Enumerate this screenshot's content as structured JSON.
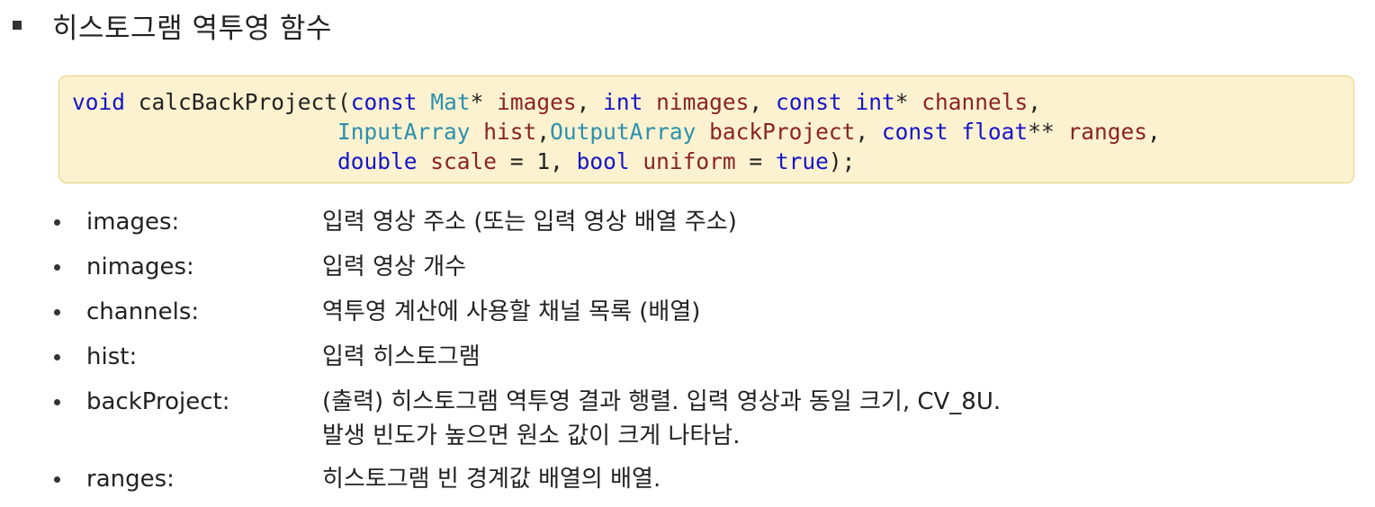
{
  "title": "히스토그램 역투영 함수",
  "code": {
    "line1": {
      "kw_void": "void",
      "fn": " calcBackProject(",
      "kw_const1": "const",
      "sp1": " ",
      "ty_mat": "Mat",
      "p1": "* ",
      "v_images": "images",
      "p2": ", ",
      "kw_int1": "int",
      "sp2": " ",
      "v_nimages": "nimages",
      "p3": ", ",
      "kw_const2": "const",
      "sp3": " ",
      "kw_int2": "int",
      "p4": "* ",
      "v_channels": "channels",
      "p5": ","
    },
    "line2": {
      "indent": "                    ",
      "ty_input": "InputArray",
      "sp1": " ",
      "v_hist": "hist",
      "p1": ",",
      "ty_output": "OutputArray",
      "sp2": " ",
      "v_backproject": "backProject",
      "p2": ", ",
      "kw_const": "const",
      "sp3": " ",
      "kw_float": "float",
      "p3": "** ",
      "v_ranges": "ranges",
      "p4": ","
    },
    "line3": {
      "indent": "                    ",
      "kw_double": "double",
      "sp1": " ",
      "v_scale": "scale",
      "p1": " = 1, ",
      "kw_bool": "bool",
      "sp2": " ",
      "v_uniform": "uniform",
      "p2": " = ",
      "kw_true": "true",
      "p3": ");"
    }
  },
  "params": [
    {
      "name": "images:",
      "desc": [
        "입력 영상 주소 (또는 입력 영상 배열 주소)"
      ]
    },
    {
      "name": "nimages:",
      "desc": [
        "입력 영상 개수"
      ]
    },
    {
      "name": "channels:",
      "desc": [
        "역투영 계산에 사용할 채널 목록 (배열)"
      ]
    },
    {
      "name": "hist:",
      "desc": [
        "입력 히스토그램"
      ]
    },
    {
      "name": "backProject:",
      "desc": [
        "(출력) 히스토그램 역투영 결과 행렬. 입력 영상과 동일 크기, CV_8U.",
        "발생 빈도가 높으면 원소 값이 크게 나타남."
      ]
    },
    {
      "name": "ranges:",
      "desc": [
        "히스토그램 빈 경계값 배열의 배열."
      ]
    }
  ],
  "colors": {
    "keyword": "#1515c9",
    "type": "#2b91af",
    "variable": "#8b2323",
    "code_background": "#fdf2cf",
    "code_border": "#e8cf77"
  }
}
